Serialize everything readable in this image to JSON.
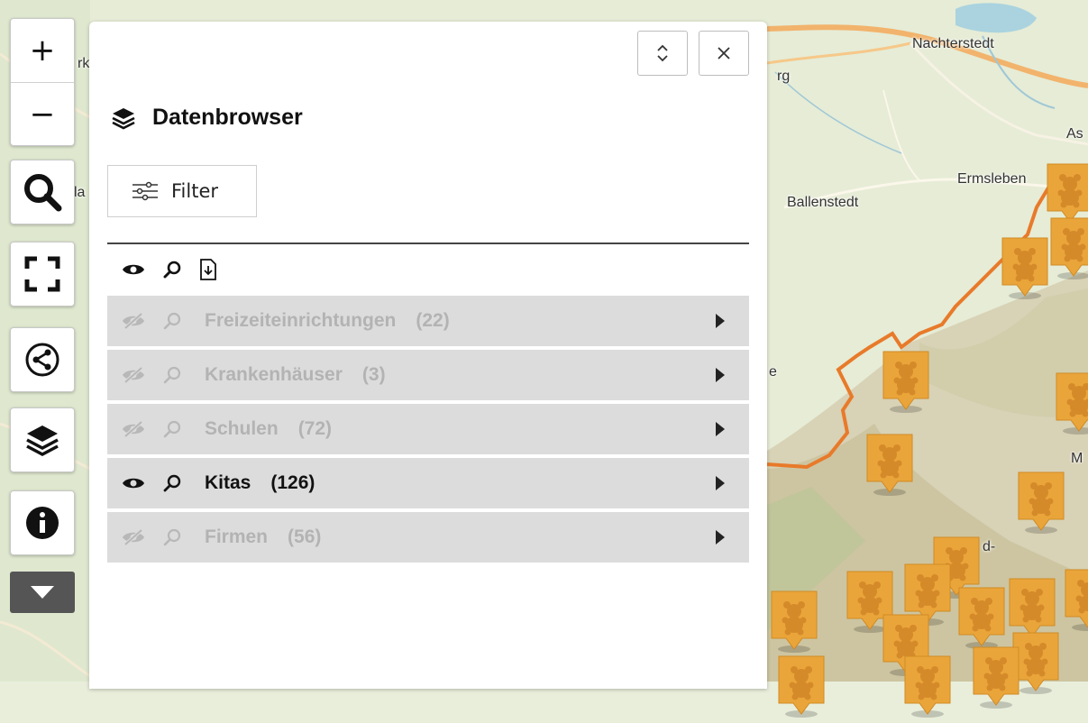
{
  "map": {
    "labels": [
      "Nachterstedt",
      "rg",
      "Ballenstedt",
      "Ermsleben",
      "As",
      "la",
      "e",
      "M",
      "d-",
      "rk"
    ],
    "colors": {
      "marker": "#eaa53a",
      "border": "#e87a2a",
      "road": "#f2b36c"
    },
    "marker_icon": "teddy-bear-icon"
  },
  "controls": {
    "zoom_in": "+",
    "zoom_out": "−",
    "icons": [
      "search-icon",
      "fullscreen-icon",
      "share-icon",
      "layers-icon",
      "info-icon",
      "chevron-down-icon"
    ]
  },
  "panel": {
    "title": "Datenbrowser",
    "title_icon": "layers-icon",
    "filter_label": "Filter",
    "toolbar_icons": [
      "eye-icon",
      "zoom-icon",
      "download-file-icon"
    ],
    "layers": [
      {
        "name": "Freizeiteinrichtungen",
        "count": "(22)",
        "visible": false
      },
      {
        "name": "Krankenhäuser",
        "count": "(3)",
        "visible": false
      },
      {
        "name": "Schulen",
        "count": "(72)",
        "visible": false
      },
      {
        "name": "Kitas",
        "count": "(126)",
        "visible": true
      },
      {
        "name": "Firmen",
        "count": "(56)",
        "visible": false
      }
    ]
  }
}
